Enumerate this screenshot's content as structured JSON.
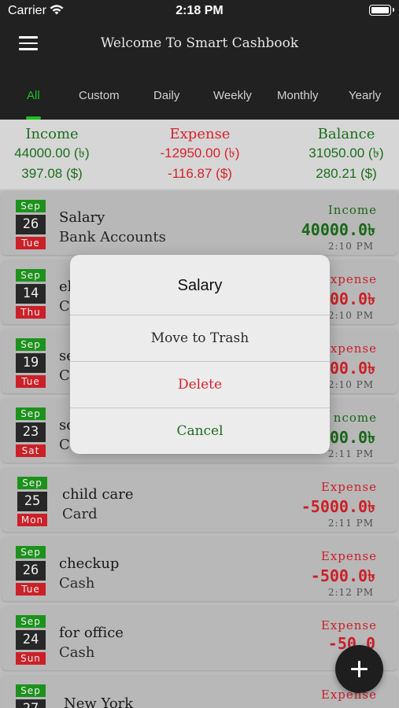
{
  "status_bar": {
    "carrier": "Carrier",
    "time": "2:18 PM"
  },
  "header": {
    "title": "Welcome To Smart Cashbook"
  },
  "tabs": [
    {
      "label": "All",
      "active": true
    },
    {
      "label": "Custom"
    },
    {
      "label": "Daily"
    },
    {
      "label": "Weekly"
    },
    {
      "label": "Monthly"
    },
    {
      "label": "Yearly"
    }
  ],
  "summary": {
    "income": {
      "label": "Income",
      "bdt": "44000.00 (৳)",
      "usd": "397.08 ($)"
    },
    "expense": {
      "label": "Expense",
      "bdt": "-12950.00 (৳)",
      "usd": "-116.87 ($)"
    },
    "balance": {
      "label": "Balance",
      "bdt": "31050.00 (৳)",
      "usd": "280.21 ($)"
    }
  },
  "transactions": [
    {
      "month": "Sep",
      "day": "26",
      "weekday": "Tue",
      "title": "Salary",
      "account": "Bank Accounts",
      "type": "Income",
      "amount": "40000.0৳",
      "time": "2:10 PM"
    },
    {
      "month": "Sep",
      "day": "14",
      "weekday": "Thu",
      "title": "el",
      "account": "C",
      "type": "xpense",
      "amount": "00.0৳",
      "time": "2:10 PM"
    },
    {
      "month": "Sep",
      "day": "19",
      "weekday": "Tue",
      "title": "se",
      "account": "C",
      "type": "xpense",
      "amount": "00.0৳",
      "time": "2:10 PM"
    },
    {
      "month": "Sep",
      "day": "23",
      "weekday": "Sat",
      "title": "sc",
      "account": "Ca",
      "type": "ncome",
      "amount": "00.0৳",
      "time": "2:11 PM"
    },
    {
      "month": "Sep",
      "day": "25",
      "weekday": "Mon",
      "title": "child care",
      "account": "Card",
      "type": "Expense",
      "amount": "-5000.0৳",
      "time": "2:11 PM"
    },
    {
      "month": "Sep",
      "day": "26",
      "weekday": "Tue",
      "title": "checkup",
      "account": "Cash",
      "type": "Expense",
      "amount": "-500.0৳",
      "time": "2:12 PM"
    },
    {
      "month": "Sep",
      "day": "24",
      "weekday": "Sun",
      "title": "for office",
      "account": "Cash",
      "type": "Expense",
      "amount": "-50.0",
      "time": "2"
    },
    {
      "month": "Sep",
      "day": "27",
      "weekday": "",
      "title": "New York",
      "account": "",
      "type": "Expense",
      "amount": "",
      "time": ""
    }
  ],
  "dialog": {
    "title": "Salary",
    "move_label": "Move to Trash",
    "delete_label": "Delete",
    "cancel_label": "Cancel"
  },
  "fab": {
    "icon": "plus-icon"
  },
  "colors": {
    "bar": "#212121",
    "accent_green": "#1fbf1f",
    "income_green": "#1b6e1b",
    "expense_red": "#d8222b"
  }
}
